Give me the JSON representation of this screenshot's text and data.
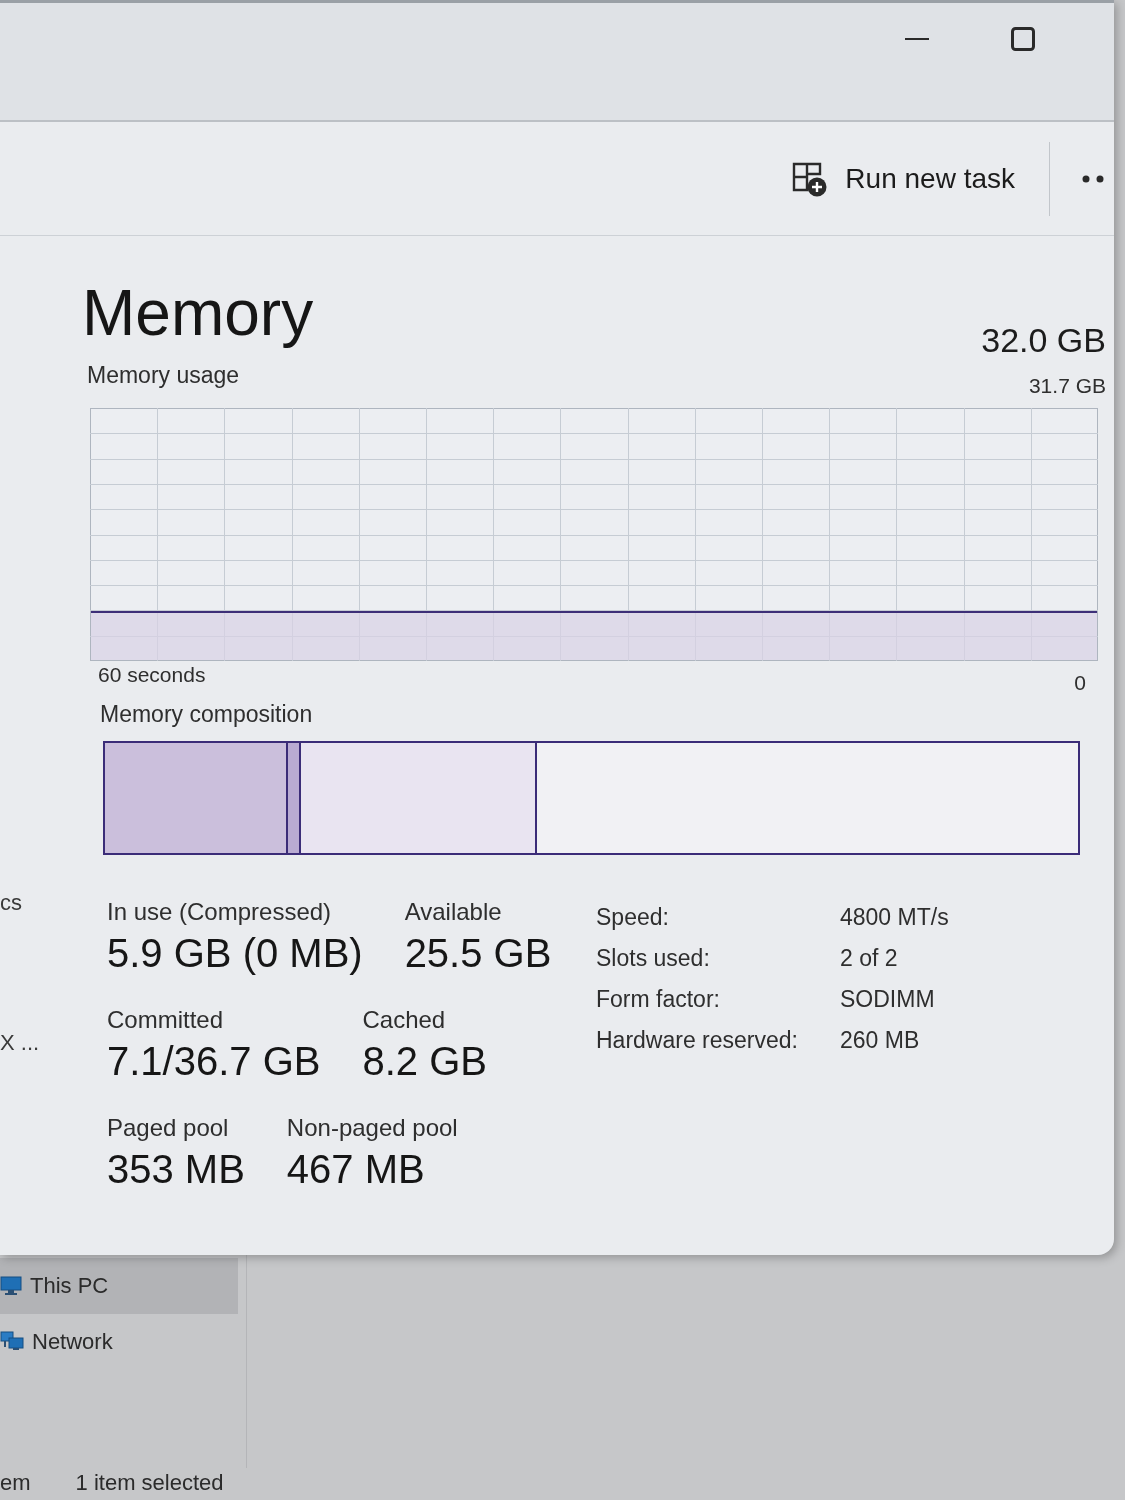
{
  "task_manager": {
    "window_controls": [
      {
        "kind": "minimize"
      },
      {
        "kind": "maximize"
      }
    ],
    "command_bar": {
      "run_new_task": "Run new task"
    },
    "sidebar": {
      "items": [
        {
          "label": "cs"
        },
        {
          "label": "X ..."
        }
      ]
    },
    "title": "Memory",
    "total": "32.0 GB",
    "usage_graph": {
      "label": "Memory usage",
      "max": "31.7 GB",
      "time_span": "60 seconds",
      "min": "0"
    },
    "composition": {
      "label": "Memory composition",
      "segments": [
        {
          "kind": "in_use",
          "level": 0.188
        },
        {
          "kind": "modified",
          "level": 0.013
        },
        {
          "kind": "standby",
          "level": 0.243
        },
        {
          "kind": "free",
          "level": 0.556
        }
      ]
    },
    "stat_rows": [
      {
        "items": [
          {
            "label": "In use (Compressed)",
            "value": "5.9 GB (0 MB)"
          },
          {
            "label": "Available",
            "value": "25.5 GB"
          }
        ]
      },
      {
        "items": [
          {
            "label": "Committed",
            "value": "7.1/36.7 GB"
          },
          {
            "label": "Cached",
            "value": "8.2 GB"
          }
        ]
      },
      {
        "items": [
          {
            "label": "Paged pool",
            "value": "353 MB"
          },
          {
            "label": "Non-paged pool",
            "value": "467 MB"
          }
        ]
      }
    ],
    "details": [
      {
        "label": "Speed:",
        "value": "4800 MT/s"
      },
      {
        "label": "Slots used:",
        "value": "2 of 2"
      },
      {
        "label": "Form factor:",
        "value": "SODIMM"
      },
      {
        "label": "Hardware reserved:",
        "value": "260 MB"
      }
    ]
  },
  "explorer": {
    "nav": [
      {
        "kind": "pc",
        "label": "This PC",
        "selected": true
      },
      {
        "kind": "network",
        "label": "Network",
        "selected": false
      }
    ],
    "status_bar": [
      {
        "text": "em"
      },
      {
        "text": "1 item selected"
      }
    ]
  }
}
